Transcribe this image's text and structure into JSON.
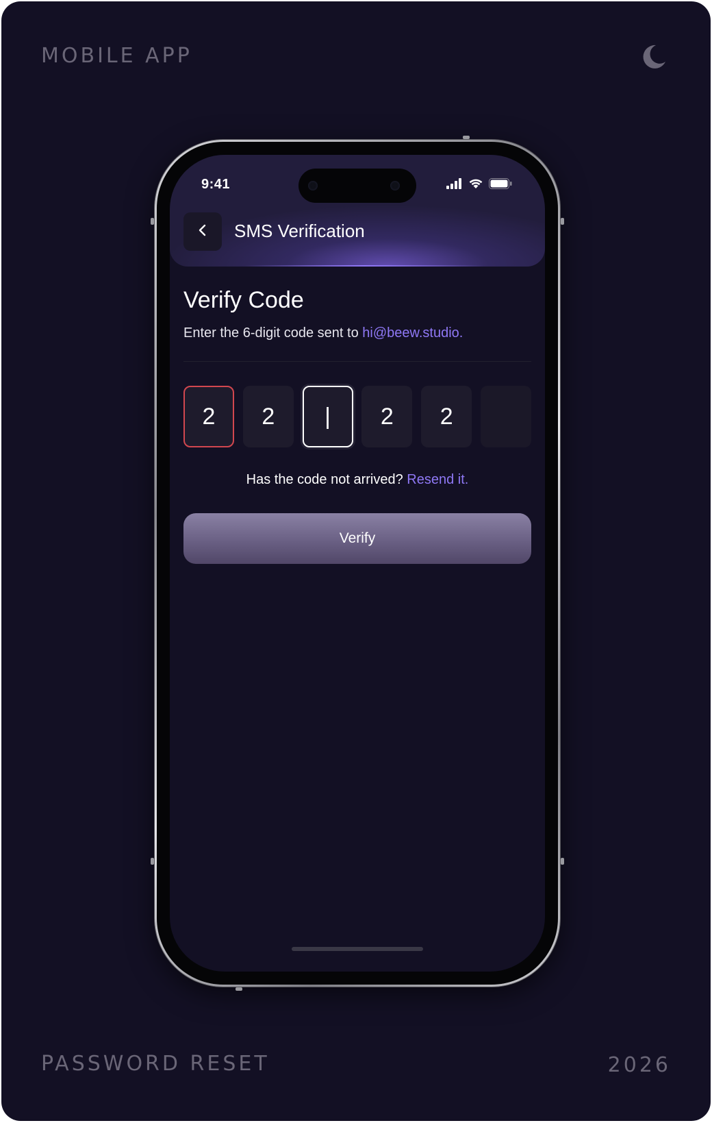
{
  "frame": {
    "top_left_label": "MOBILE APP",
    "bottom_left_label": "PASSWORD RESET",
    "bottom_right_label": "2026",
    "theme_toggle_icon": "moon-icon"
  },
  "status_bar": {
    "time": "9:41",
    "icons": [
      "cellular-signal-icon",
      "wifi-icon",
      "battery-icon"
    ]
  },
  "header": {
    "back_icon": "chevron-left-icon",
    "title": "SMS Verification"
  },
  "verify": {
    "title": "Verify Code",
    "subtitle_prefix": "Enter the 6-digit code sent to ",
    "email": "hi@beew.studio."
  },
  "otp": {
    "digits": [
      {
        "value": "2",
        "state": "error"
      },
      {
        "value": "2",
        "state": "default"
      },
      {
        "value": "|",
        "state": "focused"
      },
      {
        "value": "2",
        "state": "default"
      },
      {
        "value": "2",
        "state": "default"
      },
      {
        "value": "",
        "state": "empty"
      }
    ]
  },
  "resend": {
    "prompt": "Has the code not arrived? ",
    "link": "Resend it."
  },
  "button": {
    "label": "Verify"
  },
  "colors": {
    "background": "#131024",
    "accent": "#8f78f5",
    "error": "#d2474f",
    "button_top": "#8a81a4",
    "button_bottom": "#514768"
  }
}
